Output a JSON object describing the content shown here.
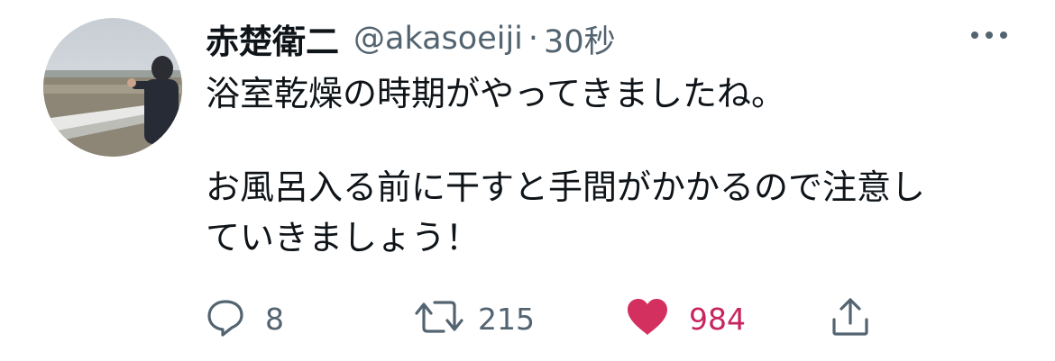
{
  "tweet": {
    "display_name": "赤楚衛二",
    "handle": "@akasoeiji",
    "separator": "·",
    "time": "30秒",
    "body_line1": "浴室乾燥の時期がやってきましたね。",
    "body_line2": "お風呂入る前に干すと手間がかかるので注意し",
    "body_line3": "ていきましょう！"
  },
  "actions": {
    "reply_count": "8",
    "retweet_count": "215",
    "like_count": "984"
  },
  "icons": {
    "more": "more-horizontal-icon",
    "reply": "reply-bubble-icon",
    "retweet": "retweet-icon",
    "like": "heart-filled-icon",
    "share": "share-upload-icon"
  },
  "colors": {
    "text": "#0f1419",
    "secondary": "#536471",
    "like": "#c9245f"
  }
}
